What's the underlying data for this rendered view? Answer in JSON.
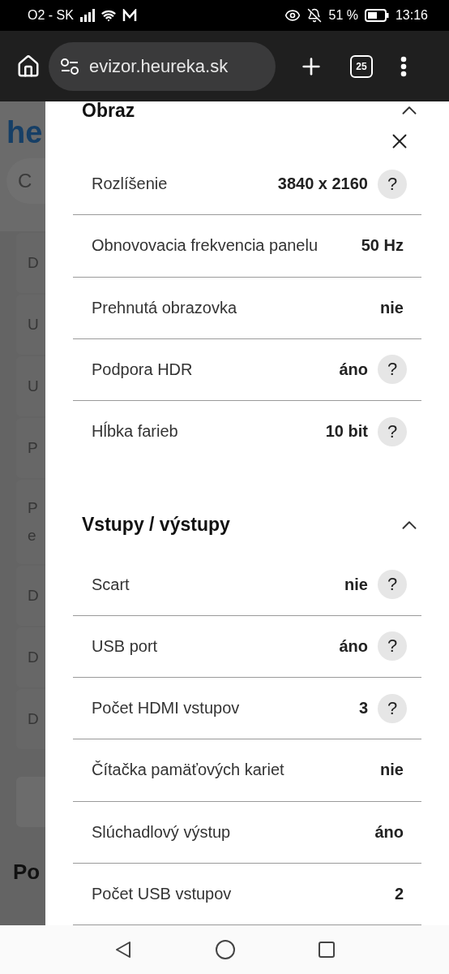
{
  "status_bar": {
    "carrier": "O2 - SK",
    "battery": "51 %",
    "time": "13:16"
  },
  "browser": {
    "url": "evizor.heureka.sk",
    "tab_count": "25"
  },
  "background_page": {
    "logo": "he",
    "search": "C",
    "items": [
      "D",
      "U",
      "U",
      "P",
      [
        "P",
        "e"
      ],
      "D",
      "D",
      "D"
    ],
    "heading": "Po"
  },
  "panel": {
    "sections": [
      {
        "title": "Obraz",
        "expanded": true,
        "rows": [
          {
            "label": "Rozlíšenie",
            "value": "3840 x 2160",
            "help": "?"
          },
          {
            "label": "Obnovovacia frekvencia panelu",
            "value": "50 Hz"
          },
          {
            "label": "Prehnutá obrazovka",
            "value": "nie"
          },
          {
            "label": "Podpora HDR",
            "value": "áno",
            "help": "?"
          },
          {
            "label": "Hĺbka farieb",
            "value": "10 bit",
            "help": "?"
          }
        ]
      },
      {
        "title": "Vstupy / výstupy",
        "expanded": true,
        "rows": [
          {
            "label": "Scart",
            "value": "nie",
            "help": "?"
          },
          {
            "label": "USB port",
            "value": "áno",
            "help": "?"
          },
          {
            "label": "Počet HDMI vstupov",
            "value": "3",
            "help": "?"
          },
          {
            "label": "Čítačka pamäťových kariet",
            "value": "nie"
          },
          {
            "label": "Slúchadlový výstup",
            "value": "áno"
          },
          {
            "label": "Počet USB vstupov",
            "value": "2"
          }
        ]
      }
    ]
  }
}
